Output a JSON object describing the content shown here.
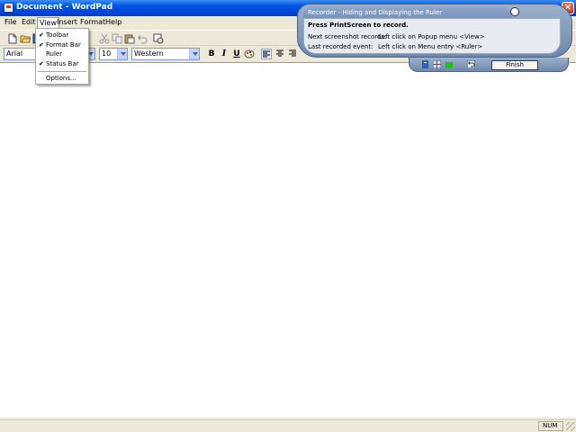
{
  "window": {
    "title": "Document - WordPad",
    "close_glyph": "×"
  },
  "menubar": {
    "items": [
      "File",
      "Edit",
      "View",
      "Insert",
      "Format",
      "Help"
    ]
  },
  "toolbar": {
    "icons": [
      "new-document-icon",
      "open-folder-icon",
      "save-icon",
      "print-icon",
      "print-preview-icon",
      "find-icon",
      "cut-icon",
      "copy-icon",
      "paste-icon",
      "undo-icon",
      "date-time-icon"
    ]
  },
  "formatbar": {
    "font_name": "Arial",
    "font_size": "10",
    "script": "Western",
    "bold_glyph": "B",
    "italic_glyph": "I",
    "underline_glyph": "U"
  },
  "view_menu": {
    "items": [
      {
        "label": "Toolbar",
        "checked": true
      },
      {
        "label": "Format Bar",
        "checked": true
      },
      {
        "label": "Ruler",
        "checked": false
      },
      {
        "label": "Status Bar",
        "checked": true
      }
    ],
    "options_label": "Options...",
    "check_glyph": "✔"
  },
  "recorder": {
    "title": "Recorder - Hiding and Displaying the Ruler",
    "main_message": "Press PrintScreen to record.",
    "next_label": "Next screenshot records:",
    "next_value": "Left click on Popup menu <View>",
    "last_label": "Last recorded event:",
    "last_value": "Left click on Menu entry <Ruler>",
    "finish_label": "Finish"
  },
  "statusbar": {
    "num_label": "NUM"
  },
  "colors": {
    "title_blue": "#0055E5",
    "face": "#ECE9D8",
    "recorder_frame": "#7892bb",
    "recorder_panel": "#e6ebf2"
  }
}
